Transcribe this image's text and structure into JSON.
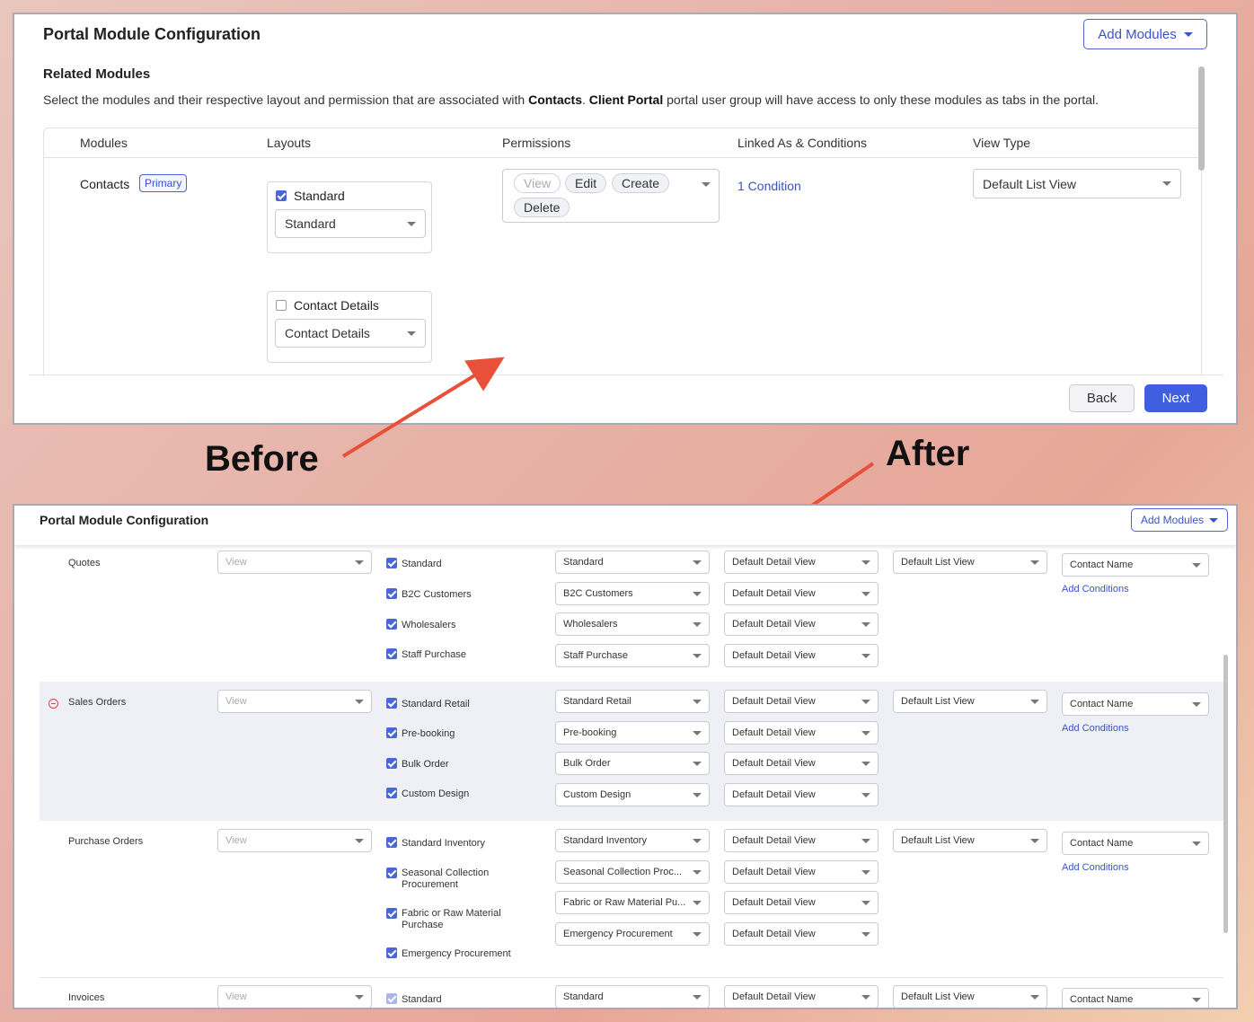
{
  "before_panel": {
    "title": "Portal Module Configuration",
    "add_modules_label": "Add Modules",
    "section_title": "Related Modules",
    "description_pre": "Select the modules and their respective layout and permission that are associated with ",
    "description_bold1": "Contacts",
    "description_mid": ". ",
    "description_bold2": "Client Portal",
    "description_post": " portal user group will have access to only these modules as tabs in the portal.",
    "columns": [
      "Modules",
      "Layouts",
      "Permissions",
      "Linked As & Conditions",
      "View Type"
    ],
    "row": {
      "module": "Contacts",
      "badge": "Primary",
      "layouts": [
        {
          "label": "Standard",
          "checked": true,
          "select": "Standard"
        },
        {
          "label": "Contact Details",
          "checked": false,
          "select": "Contact Details"
        }
      ],
      "permissions": [
        "View",
        "Edit",
        "Create",
        "Delete"
      ],
      "condition_link": "1 Condition",
      "view_type": "Default List View"
    },
    "back_label": "Back",
    "next_label": "Next"
  },
  "labels": {
    "before": "Before",
    "after": "After"
  },
  "after_panel": {
    "title": "Portal Module Configuration",
    "add_modules_label": "Add Modules",
    "modules": [
      {
        "name": "Quotes",
        "permission": "View",
        "list_view": "Default List View",
        "linked_field": "Contact Name",
        "add_conditions": "Add Conditions",
        "layouts": [
          {
            "label": "Standard",
            "select": "Standard",
            "detail": "Default Detail View"
          },
          {
            "label": "B2C Customers",
            "select": "B2C Customers",
            "detail": "Default Detail View"
          },
          {
            "label": "Wholesalers",
            "select": "Wholesalers",
            "detail": "Default Detail View"
          },
          {
            "label": "Staff Purchase",
            "select": "Staff Purchase",
            "detail": "Default Detail View"
          }
        ]
      },
      {
        "name": "Sales Orders",
        "permission": "View",
        "list_view": "Default List View",
        "linked_field": "Contact Name",
        "add_conditions": "Add Conditions",
        "layouts": [
          {
            "label": "Standard Retail",
            "select": "Standard Retail",
            "detail": "Default Detail View"
          },
          {
            "label": "Pre-booking",
            "select": "Pre-booking",
            "detail": "Default Detail View"
          },
          {
            "label": "Bulk Order",
            "select": "Bulk Order",
            "detail": "Default Detail View"
          },
          {
            "label": "Custom Design",
            "select": "Custom Design",
            "detail": "Default Detail View"
          }
        ]
      },
      {
        "name": "Purchase Orders",
        "permission": "View",
        "list_view": "Default List View",
        "linked_field": "Contact Name",
        "add_conditions": "Add Conditions",
        "layouts": [
          {
            "label": "Standard Inventory",
            "select": "Standard Inventory",
            "detail": "Default Detail View"
          },
          {
            "label": "Seasonal Collection Procurement",
            "select": "Seasonal Collection Proc...",
            "detail": "Default Detail View"
          },
          {
            "label": "Fabric or Raw Material Purchase",
            "select": "Fabric or Raw Material Pu...",
            "detail": "Default Detail View"
          },
          {
            "label": "Emergency Procurement",
            "select": "Emergency Procurement",
            "detail": "Default Detail View"
          }
        ]
      },
      {
        "name": "Invoices",
        "permission": "View",
        "list_view": "Default List View",
        "linked_field": "Contact Name",
        "layouts": [
          {
            "label": "Standard",
            "select": "Standard",
            "detail": "Default Detail View"
          }
        ]
      }
    ]
  },
  "colors": {
    "accent": "#3f5fe0",
    "link": "#3a52c9",
    "arrow": "#e8503a",
    "remove": "#e0443e"
  }
}
